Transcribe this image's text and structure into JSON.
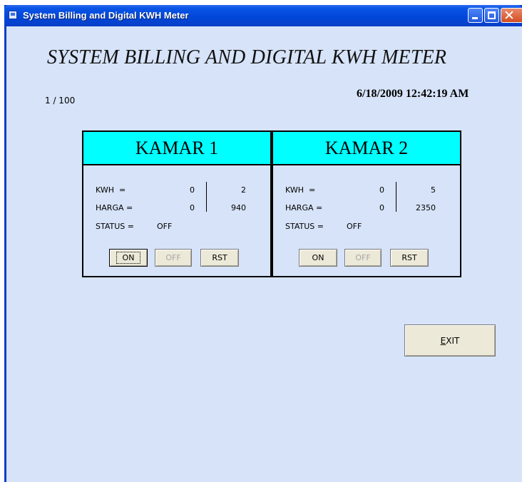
{
  "window": {
    "title": "System Billing and Digital KWH Meter"
  },
  "header": {
    "title": "SYSTEM BILLING AND DIGITAL KWH METER",
    "counter": "1 / 100",
    "datetime": "6/18/2009 12:42:19 AM"
  },
  "rooms": [
    {
      "name": "KAMAR 1",
      "kwh_label": "KWH",
      "eq": "=",
      "kwh_value": "0",
      "kwh_right": "2",
      "harga_label": "HARGA =",
      "harga_value": "0",
      "harga_right": "940",
      "status_label": "STATUS =",
      "status_value": "OFF",
      "on_label": "ON",
      "off_label": "OFF",
      "rst_label": "RST"
    },
    {
      "name": "KAMAR 2",
      "kwh_label": "KWH",
      "eq": "=",
      "kwh_value": "0",
      "kwh_right": "5",
      "harga_label": "HARGA =",
      "harga_value": "0",
      "harga_right": "2350",
      "status_label": "STATUS =",
      "status_value": "OFF",
      "on_label": "ON",
      "off_label": "OFF",
      "rst_label": "RST"
    }
  ],
  "exit": {
    "prefix": "E",
    "rest": "XIT"
  },
  "colors": {
    "panel_header": "#00ffff",
    "client_bg": "#d6e3f8",
    "titlebar": "#0a3fc7"
  }
}
